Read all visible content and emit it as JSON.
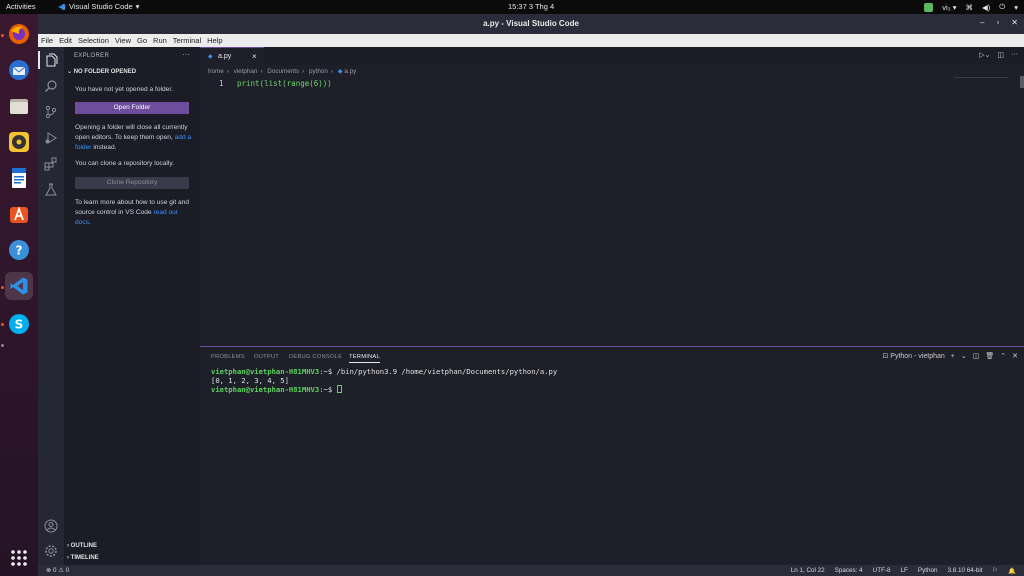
{
  "topbar": {
    "activities": "Activities",
    "app_name": "Visual Studio Code",
    "clock": "15:37  3 Thg 4",
    "input_method": "vi₃"
  },
  "window": {
    "title": "a.py - Visual Studio Code"
  },
  "menu": [
    "File",
    "Edit",
    "Selection",
    "View",
    "Go",
    "Run",
    "Terminal",
    "Help"
  ],
  "sidebar": {
    "header": "EXPLORER",
    "section": "NO FOLDER OPENED",
    "not_opened": "You have not yet opened a folder.",
    "open_folder_btn": "Open Folder",
    "warning_pre": "Opening a folder will close all currently open editors. To keep them open,",
    "warning_link": "add a folder",
    "warning_post": "instead.",
    "clone_text": "You can clone a repository locally.",
    "clone_btn": "Clone Repository",
    "learn_pre": "To learn more about how to use git and source control in VS Code",
    "learn_link": "read our docs",
    "learn_post": ".",
    "outline": "OUTLINE",
    "timeline": "TIMELINE"
  },
  "editor": {
    "tab": "a.py",
    "breadcrumb": [
      "home",
      "vietphan",
      "Documents",
      "python",
      "a.py"
    ],
    "line_number": "1",
    "code_line": "print(list(range(6)))"
  },
  "panel": {
    "tabs": [
      "PROBLEMS",
      "OUTPUT",
      "DEBUG CONSOLE",
      "TERMINAL"
    ],
    "terminal_name": "Python - vietphan",
    "prompt_user": "vietphan@vietphan-H81MHV3",
    "prompt_path": ":~$ ",
    "command": "/bin/python3.9 /home/vietphan/Documents/python/a.py",
    "output": "[0, 1, 2, 3, 4, 5]",
    "prompt_user_2": "vietphan@vietphan-H81MHV3",
    "prompt_path_2": ":~$ "
  },
  "statusbar": {
    "problems": "⊗ 0 ⚠ 0",
    "position": "Ln 1, Col 22",
    "spaces": "Spaces: 4",
    "encoding": "UTF-8",
    "eol": "LF",
    "language": "Python",
    "interpreter": "3.8.10 64-bit"
  },
  "colors": {
    "accent": "#6d4d9c",
    "link": "#3794ff",
    "terminal_green": "#5fd35f"
  }
}
